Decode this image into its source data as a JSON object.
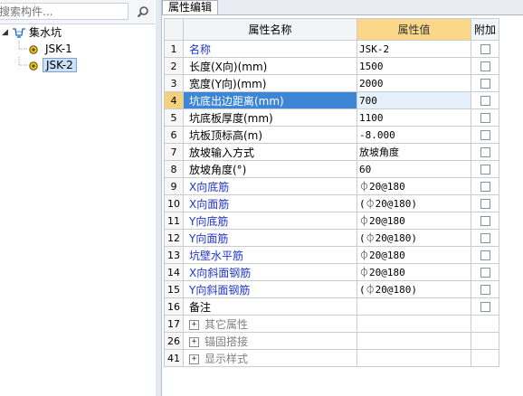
{
  "search": {
    "placeholder": "搜索构件..."
  },
  "tree": {
    "root_label": "集水坑",
    "items": [
      {
        "label": "JSK-1",
        "selected": false
      },
      {
        "label": "JSK-2",
        "selected": true
      }
    ]
  },
  "tab": {
    "label": "属性编辑"
  },
  "table": {
    "headers": {
      "name": "属性名称",
      "value": "属性值",
      "extra": "附加"
    },
    "rows": [
      {
        "num": "1",
        "name": "名称",
        "value": "JSK-2",
        "blue": true
      },
      {
        "num": "2",
        "name": "长度(X向)(mm)",
        "value": "1500",
        "blue": false
      },
      {
        "num": "3",
        "name": "宽度(Y向)(mm)",
        "value": "2000",
        "blue": false
      },
      {
        "num": "4",
        "name": "坑底出边距离(mm)",
        "value": "700",
        "blue": false,
        "selected": true
      },
      {
        "num": "5",
        "name": "坑底板厚度(mm)",
        "value": "1100",
        "blue": false
      },
      {
        "num": "6",
        "name": "坑板顶标高(m)",
        "value": "-8.000",
        "blue": false
      },
      {
        "num": "7",
        "name": "放坡输入方式",
        "value": "放坡角度",
        "blue": false
      },
      {
        "num": "8",
        "name": "放坡角度(°)",
        "value": "60",
        "blue": false
      },
      {
        "num": "9",
        "name": "X向底筋",
        "value": "⏀20@180",
        "blue": true
      },
      {
        "num": "10",
        "name": "X向面筋",
        "value": "(⏀20@180)",
        "blue": true
      },
      {
        "num": "11",
        "name": "Y向底筋",
        "value": "⏀20@180",
        "blue": true
      },
      {
        "num": "12",
        "name": "Y向面筋",
        "value": "(⏀20@180)",
        "blue": true
      },
      {
        "num": "13",
        "name": "坑壁水平筋",
        "value": "⏀20@180",
        "blue": true
      },
      {
        "num": "14",
        "name": "X向斜面钢筋",
        "value": "⏀20@180",
        "blue": true
      },
      {
        "num": "15",
        "name": "Y向斜面钢筋",
        "value": "(⏀20@180)",
        "blue": true
      },
      {
        "num": "16",
        "name": "备注",
        "value": "",
        "blue": false
      }
    ],
    "groups": [
      {
        "num": "17",
        "name": "其它属性"
      },
      {
        "num": "26",
        "name": "锚固搭接"
      },
      {
        "num": "41",
        "name": "显示样式"
      }
    ]
  },
  "colors": {
    "header_highlight": "#fbd889",
    "selected_row": "#3d86d6",
    "blue_text": "#1f35c8",
    "group_text": "#808080"
  },
  "icons": [
    "search-icon",
    "pit-icon",
    "component-icon",
    "checkbox-icon",
    "expand-icon"
  ]
}
